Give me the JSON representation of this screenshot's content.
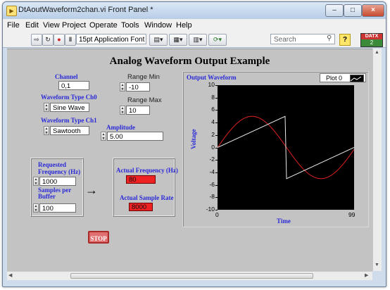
{
  "window": {
    "title": "DtAoutWaveform2chan.vi Front Panel *",
    "minimize": "–",
    "maximize": "□",
    "close": "×"
  },
  "menu": [
    "File",
    "Edit",
    "View",
    "Project",
    "Operate",
    "Tools",
    "Window",
    "Help"
  ],
  "toolbar": {
    "font": "15pt Application Font",
    "search_placeholder": "Search",
    "help": "?",
    "datx_top": "DATX",
    "datx_bottom": "2"
  },
  "panel": {
    "title": "Analog Waveform Output Example",
    "channel": {
      "label": "Channel",
      "value": "0,1"
    },
    "type_ch0": {
      "label": "Waveform Type Ch0",
      "value": "Sine Wave"
    },
    "type_ch1": {
      "label": "Waveform Type Ch1",
      "value": "Sawtooth"
    },
    "range_min": {
      "label": "Range Min",
      "value": "-10"
    },
    "range_max": {
      "label": "Range Max",
      "value": "10"
    },
    "amplitude": {
      "label": "Amplitude",
      "value": "5.00"
    },
    "req_freq": {
      "label_line1": "Requested",
      "label_line2": "Frequency (Hz)",
      "value": "1000"
    },
    "samples": {
      "label_line1": "Samples per",
      "label_line2": "Buffer",
      "value": "100"
    },
    "actual_freq": {
      "label": "Actual Frequency (Hz)",
      "value": "80"
    },
    "actual_rate": {
      "label": "Actual Sample Rate",
      "value": "8000"
    },
    "stop": "STOP",
    "arrow": "→"
  },
  "graph": {
    "title": "Output Waveform",
    "legend": "Plot 0",
    "sine_color": "#e02020",
    "saw_color": "#e8e8e8"
  },
  "chart_data": {
    "type": "line",
    "title": "Output Waveform",
    "xlabel": "Time",
    "ylabel": "Voltage",
    "xlim": [
      0,
      99
    ],
    "ylim": [
      -10,
      10
    ],
    "y_ticks": [
      10,
      8,
      6,
      4,
      2,
      0,
      -2,
      -4,
      -6,
      -8,
      -10
    ],
    "x_ticks": [
      0,
      99
    ],
    "series": [
      {
        "name": "Plot 0",
        "shape": "sine",
        "amplitude": 5,
        "period": 100,
        "x": [
          0,
          25,
          50,
          75,
          99
        ],
        "y": [
          0,
          5,
          0,
          -5,
          -0.3
        ]
      },
      {
        "shape": "sawtooth",
        "amplitude": 5,
        "x": [
          0,
          49,
          50,
          99
        ],
        "y": [
          0,
          5,
          -5,
          0
        ]
      }
    ],
    "grid": false
  }
}
